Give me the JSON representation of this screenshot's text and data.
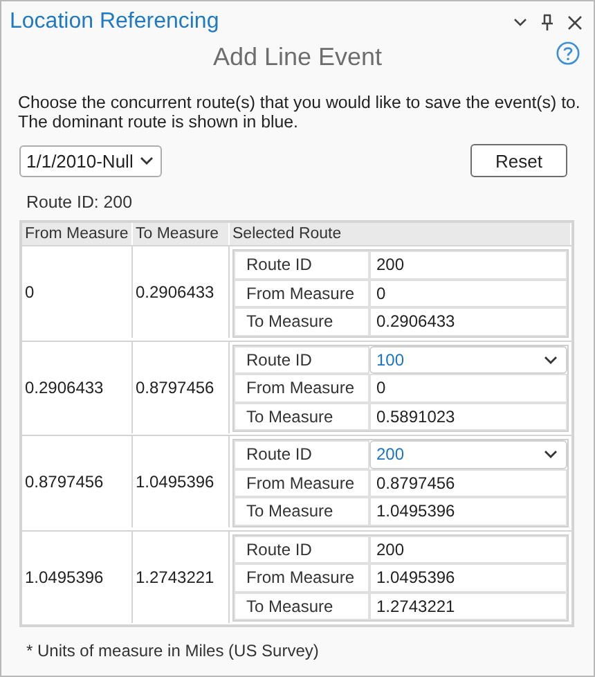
{
  "panel": {
    "title": "Location Referencing"
  },
  "heading": "Add Line Event",
  "instructions": [
    "Choose the concurrent route(s) that you would like to save the event(s) to.",
    "The dominant route is shown in blue."
  ],
  "date_dropdown": {
    "value": "1/1/2010-Null"
  },
  "reset_button": "Reset",
  "route_id_label": "Route ID: 200",
  "table": {
    "columns": [
      "From Measure",
      "To Measure",
      "Selected Route"
    ],
    "rows": [
      {
        "from": "0",
        "to": "0.2906433",
        "selected_route": [
          {
            "label": "Route ID",
            "value": "200",
            "kind": "text"
          },
          {
            "label": "From Measure",
            "value": "0",
            "kind": "text"
          },
          {
            "label": "To Measure",
            "value": "0.2906433",
            "kind": "text"
          }
        ]
      },
      {
        "from": "0.2906433",
        "to": "0.8797456",
        "selected_route": [
          {
            "label": "Route ID",
            "value": "100",
            "kind": "dropdown"
          },
          {
            "label": "From Measure",
            "value": "0",
            "kind": "text"
          },
          {
            "label": "To Measure",
            "value": "0.5891023",
            "kind": "text"
          }
        ]
      },
      {
        "from": "0.8797456",
        "to": "1.0495396",
        "selected_route": [
          {
            "label": "Route ID",
            "value": "200",
            "kind": "dropdown"
          },
          {
            "label": "From Measure",
            "value": "0.8797456",
            "kind": "text"
          },
          {
            "label": "To Measure",
            "value": "1.0495396",
            "kind": "text"
          }
        ]
      },
      {
        "from": "1.0495396",
        "to": "1.2743221",
        "selected_route": [
          {
            "label": "Route ID",
            "value": "200",
            "kind": "text"
          },
          {
            "label": "From Measure",
            "value": "1.0495396",
            "kind": "text"
          },
          {
            "label": "To Measure",
            "value": "1.2743221",
            "kind": "text"
          }
        ]
      }
    ]
  },
  "footnote": "* Units of measure in Miles (US Survey)"
}
